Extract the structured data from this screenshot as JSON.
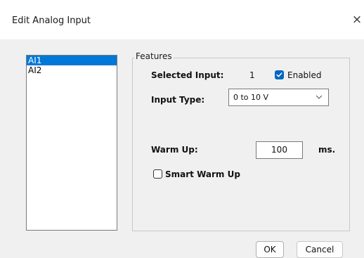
{
  "window": {
    "title": "Edit Analog Input",
    "close_glyph": "×"
  },
  "inputs_list": {
    "items": [
      "AI1",
      "AI2"
    ],
    "selected_index": 0
  },
  "features": {
    "group_label": "Features",
    "selected_input_label": "Selected Input:",
    "selected_input_value": "1",
    "enabled_label": "Enabled",
    "enabled_checked": true,
    "input_type_label": "Input Type:",
    "input_type_value": "0 to 10 V",
    "warm_up_label": "Warm Up:",
    "warm_up_value": "100",
    "warm_up_unit": "ms.",
    "smart_warm_up_label": "Smart Warm Up",
    "smart_warm_up_checked": false
  },
  "buttons": {
    "ok_label": "OK",
    "cancel_label": "Cancel"
  },
  "colors": {
    "accent": "#0078d7",
    "checkbox_checked": "#0067c0",
    "dialog_bg": "#f0f0f0"
  },
  "icons": {
    "close": "close-icon",
    "dropdown": "chevron-down-icon",
    "check": "checkmark-icon"
  }
}
